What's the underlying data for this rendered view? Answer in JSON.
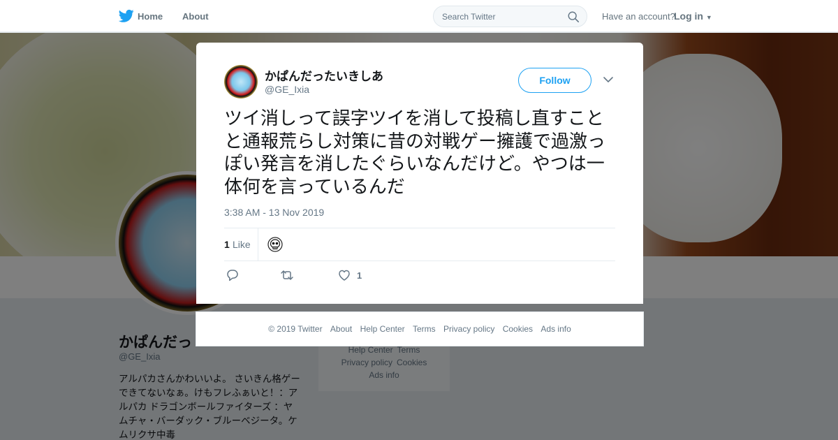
{
  "nav": {
    "home_label": "Home",
    "about_label": "About",
    "search_placeholder": "Search Twitter",
    "have_account": "Have an account?",
    "login_label": "Log in"
  },
  "profile": {
    "name": "かぱんだっ",
    "handle": "@GE_Ixia",
    "bio": "アルパカさんかわいいよ。 さいきん格ゲーできてないなぁ。けもフレふぁいと！：アルパカ ドラゴンボールファイターズ ：ヤムチャ・バーダック・ブルーベジータ。ケムリクサ中毒"
  },
  "side_footer": {
    "line1": [
      "Help Center",
      "Terms"
    ],
    "line2": [
      "Privacy policy",
      "Cookies"
    ],
    "line3": [
      "Ads info"
    ]
  },
  "tweet": {
    "author_name": "かぱんだったいきしあ",
    "author_handle": "@GE_Ixia",
    "follow_label": "Follow",
    "text": "ツイ消しって誤字ツイを消して投稿し直すことと通報荒らし対策に昔の対戦ゲー擁護で過激っぽい発言を消したぐらいなんだけど。やつは一体何を言っているんだ",
    "timestamp": "3:38 AM - 13 Nov 2019",
    "likes_count": "1",
    "likes_label": "Like",
    "like_action_count": "1"
  },
  "footer": {
    "copyright": "© 2019 Twitter",
    "links": [
      "About",
      "Help Center",
      "Terms",
      "Privacy policy",
      "Cookies",
      "Ads info"
    ]
  },
  "colors": {
    "accent": "#1da1f2",
    "text_secondary": "#657786"
  },
  "icons": {
    "logo": "twitter-bird-icon",
    "search": "search-icon",
    "close": "close-icon",
    "more": "chevron-down-icon",
    "reply": "reply-icon",
    "retweet": "retweet-icon",
    "like": "heart-icon",
    "liker": "skull-icon"
  }
}
